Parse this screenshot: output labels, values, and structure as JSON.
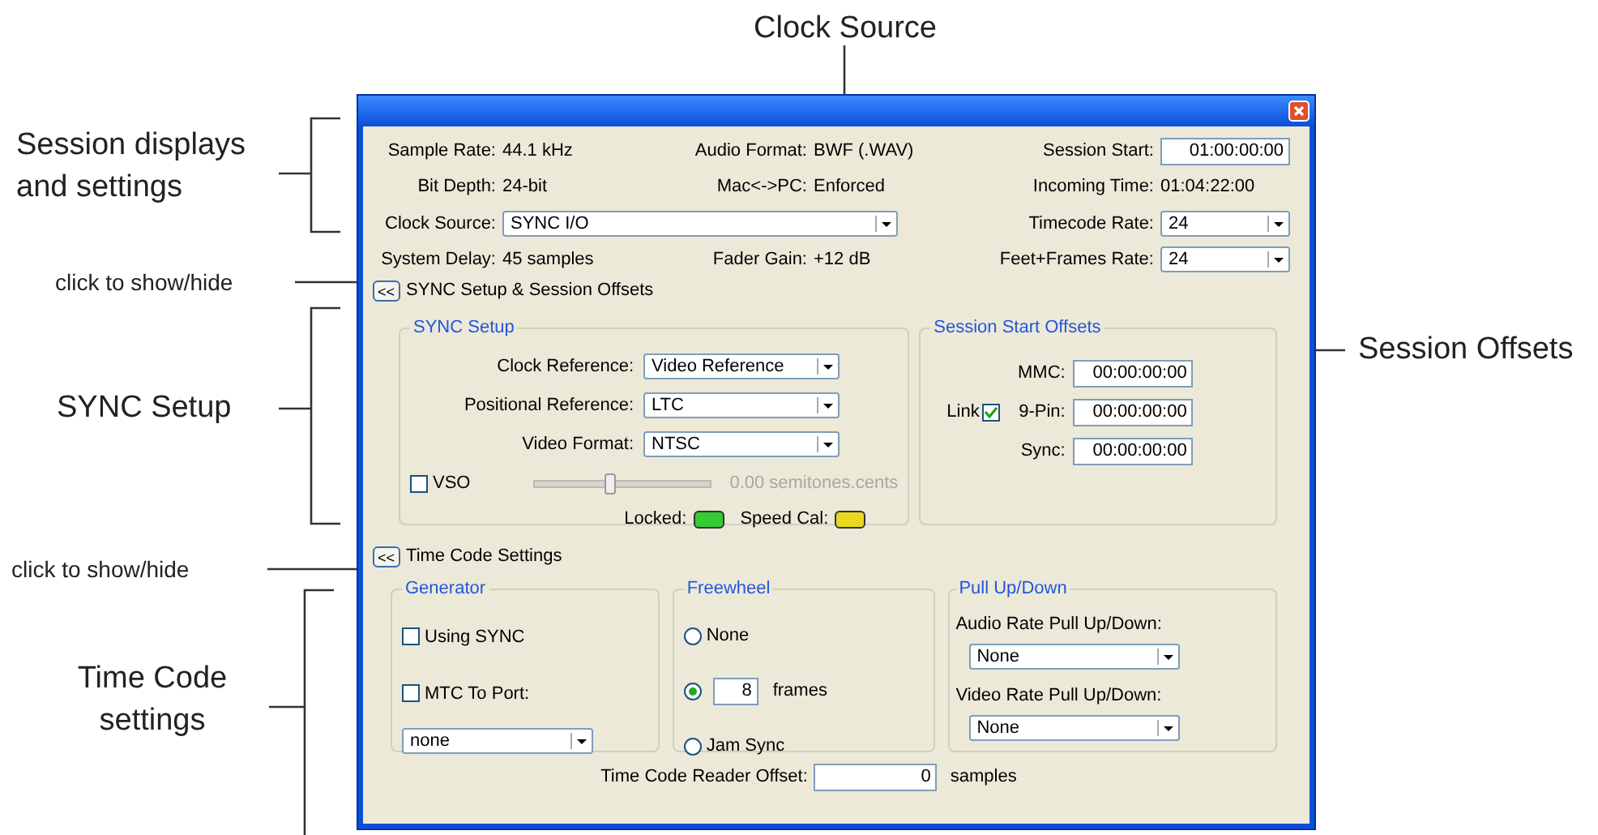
{
  "callouts": [
    {
      "text": "Clock Source"
    },
    {
      "text": "Session displays and settings"
    },
    {
      "text": "click to show/hide"
    },
    {
      "text": "SYNC Setup"
    },
    {
      "text": "Session Offsets"
    },
    {
      "text": "click to show/hide"
    },
    {
      "text": "Time Code settings"
    }
  ],
  "session_rows": [
    [
      {
        "label": "Sample Rate:",
        "value": "44.1 kHz",
        "kind": "text"
      },
      {
        "label": "Audio Format:",
        "value": "BWF (.WAV)",
        "kind": "text"
      },
      {
        "label": "Session Start:",
        "value": "01:00:00:00",
        "kind": "field"
      }
    ],
    [
      {
        "label": "Bit Depth:",
        "value": "24-bit",
        "kind": "text"
      },
      {
        "label": "Mac<->PC:",
        "value": "Enforced",
        "kind": "text"
      },
      {
        "label": "Incoming Time:",
        "value": "01:04:22:00",
        "kind": "text"
      }
    ],
    [
      {
        "label": "Clock Source:",
        "value": "SYNC I/O",
        "kind": "dropdown"
      },
      {
        "label": "Timecode Rate:",
        "value": "24",
        "kind": "dropdown"
      }
    ],
    [
      {
        "label": "System Delay:",
        "value": "45 samples",
        "kind": "text"
      },
      {
        "label": "Fader Gain:",
        "value": "+12 dB",
        "kind": "text"
      },
      {
        "label": "Feet+Frames Rate:",
        "value": "24",
        "kind": "dropdown"
      }
    ]
  ],
  "sync_toggle": {
    "button": "<<",
    "label": "SYNC Setup & Session Offsets"
  },
  "sync_setup": {
    "title": "SYNC Setup",
    "selects": [
      {
        "label": "Clock Reference:",
        "value": "Video Reference"
      },
      {
        "label": "Positional Reference:",
        "value": "LTC"
      },
      {
        "label": "Video Format:",
        "value": "NTSC"
      }
    ],
    "vso": {
      "label": "VSO",
      "checked": false,
      "level": 0.42,
      "reading": "0.00",
      "unit": "semitones.cents"
    },
    "indicators": [
      {
        "label": "Locked:",
        "color": "#33cc33"
      },
      {
        "label": "Speed Cal:",
        "color": "#e8d820"
      }
    ]
  },
  "session_offsets": {
    "title": "Session Start Offsets",
    "link": {
      "label": "Link",
      "checked": true
    },
    "fields": [
      {
        "label": "MMC:",
        "value": "00:00:00:00"
      },
      {
        "label": "9-Pin:",
        "value": "00:00:00:00"
      },
      {
        "label": "Sync:",
        "value": "00:00:00:00"
      }
    ]
  },
  "timecode_toggle": {
    "button": "<<",
    "label": "Time Code Settings"
  },
  "generator": {
    "title": "Generator",
    "checks": [
      {
        "label": "Using SYNC",
        "checked": false
      },
      {
        "label": "MTC To Port:",
        "checked": false
      }
    ],
    "select": "none"
  },
  "freewheel": {
    "title": "Freewheel",
    "options": [
      {
        "kind": "label",
        "label": "None",
        "selected": false
      },
      {
        "kind": "frames",
        "value": "8",
        "unit": "frames",
        "selected": true
      },
      {
        "kind": "label",
        "label": "Jam Sync",
        "selected": false
      }
    ]
  },
  "pull": {
    "title": "Pull Up/Down",
    "selects": [
      {
        "label": "Audio Rate Pull Up/Down:",
        "value": "None"
      },
      {
        "label": "Video Rate Pull Up/Down:",
        "value": "None"
      }
    ]
  },
  "reader_offset": {
    "label": "Time Code Reader Offset:",
    "value": "0",
    "unit": "samples"
  }
}
